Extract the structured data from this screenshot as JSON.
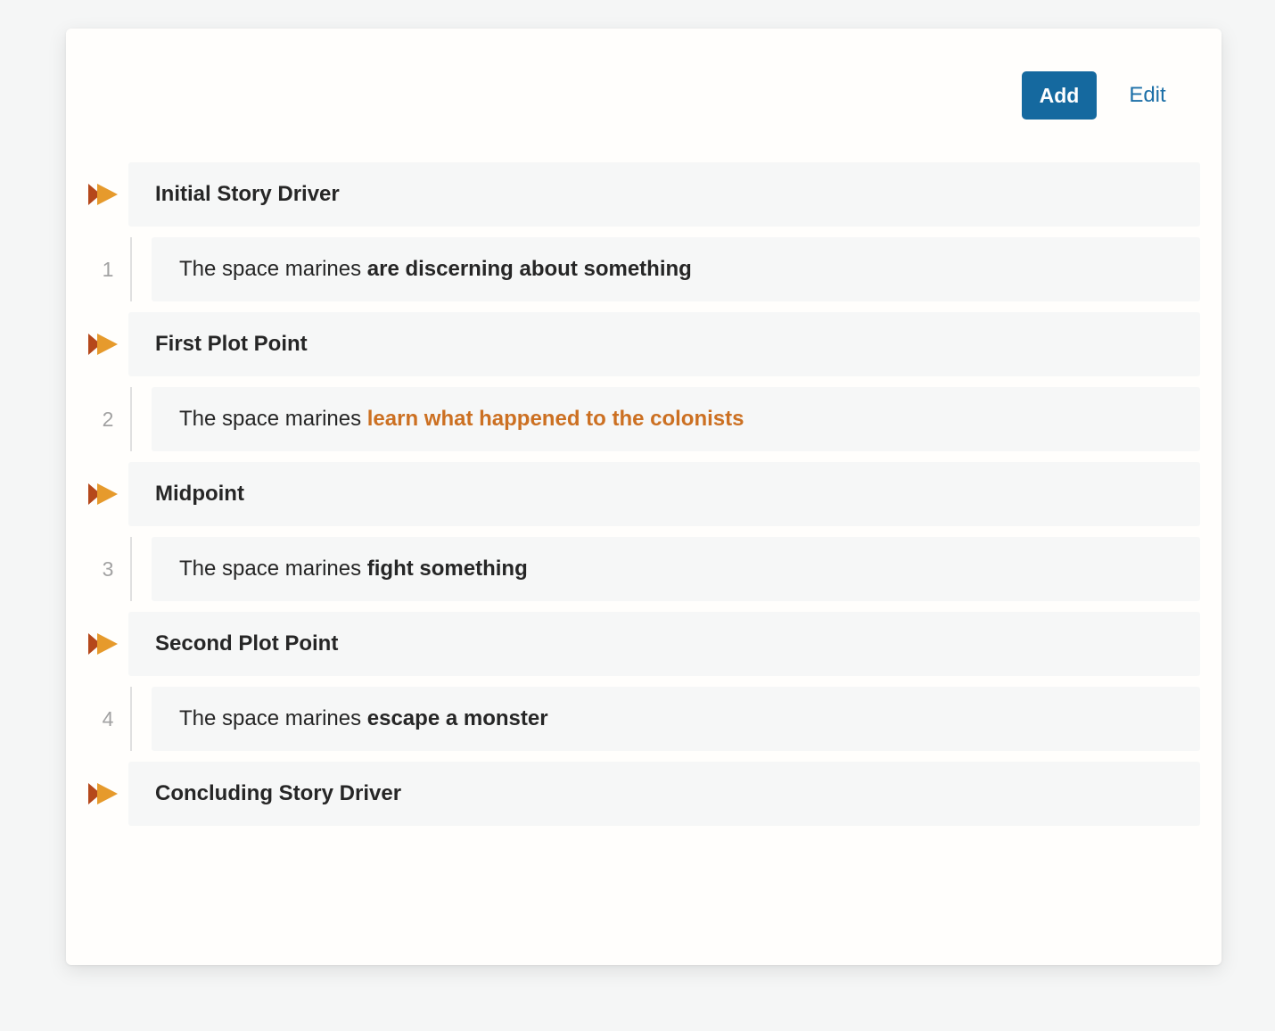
{
  "toolbar": {
    "add_label": "Add",
    "edit_label": "Edit"
  },
  "colors": {
    "primary": "#15699f",
    "link": "#1c6fa7",
    "accent_orange": "#cc7022",
    "icon_dark": "#b5481b",
    "icon_light": "#e69a2c"
  },
  "drivers": [
    {
      "label": "Initial Story Driver",
      "icon": "fast-forward-icon"
    },
    {
      "label": "First Plot Point",
      "icon": "fast-forward-icon"
    },
    {
      "label": "Midpoint",
      "icon": "fast-forward-icon"
    },
    {
      "label": "Second Plot Point",
      "icon": "fast-forward-icon"
    },
    {
      "label": "Concluding Story Driver",
      "icon": "fast-forward-icon"
    }
  ],
  "plot_events": [
    {
      "number": "1",
      "subject": "The space marines ",
      "action": "are discerning about something",
      "highlighted": false
    },
    {
      "number": "2",
      "subject": "The space marines ",
      "action": "learn what happened to the colonists",
      "highlighted": true
    },
    {
      "number": "3",
      "subject": "The space marines ",
      "action": "fight something",
      "highlighted": false
    },
    {
      "number": "4",
      "subject": "The space marines ",
      "action": "escape a monster",
      "highlighted": false
    }
  ]
}
